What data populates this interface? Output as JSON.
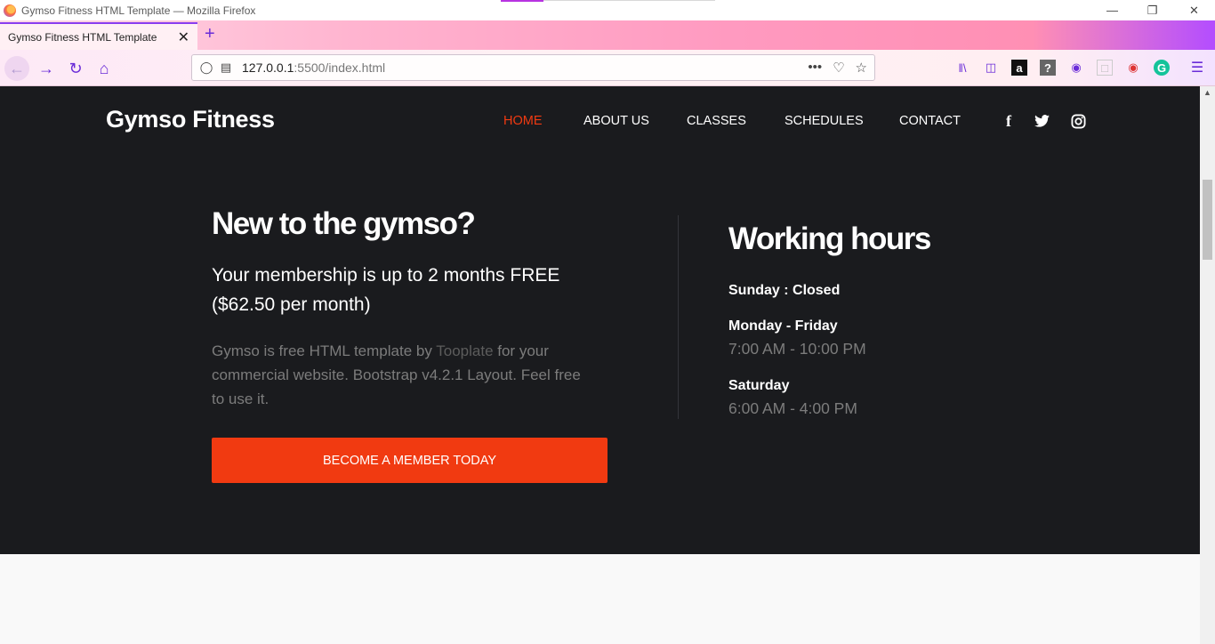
{
  "browser": {
    "window_title": "Gymso Fitness HTML Template — Mozilla Firefox",
    "tab_title": "Gymso Fitness HTML Template",
    "url_host": "127.0.0.1",
    "url_rest": ":5500/index.html"
  },
  "site": {
    "brand": "Gymso Fitness",
    "menu": [
      "HOME",
      "ABOUT US",
      "CLASSES",
      "SCHEDULES",
      "CONTACT"
    ],
    "active_menu": "HOME",
    "social": [
      "facebook-icon",
      "twitter-icon",
      "instagram-icon"
    ],
    "accent_color": "#f13a11"
  },
  "hero": {
    "title": "New to the gymso?",
    "lead": "Your membership is up to 2 months FREE ($62.50 per month)",
    "desc_before": "Gymso is free HTML template by ",
    "desc_link": "Tooplate",
    "desc_after": " for your commercial website. Bootstrap v4.2.1 Layout. Feel free to use it.",
    "cta": "BECOME A MEMBER TODAY"
  },
  "hours": {
    "title": "Working hours",
    "sunday": "Sunday : Closed",
    "weekday_label": "Monday - Friday",
    "weekday_time": "7:00 AM - 10:00 PM",
    "saturday_label": "Saturday",
    "saturday_time": "6:00 AM - 4:00 PM"
  }
}
